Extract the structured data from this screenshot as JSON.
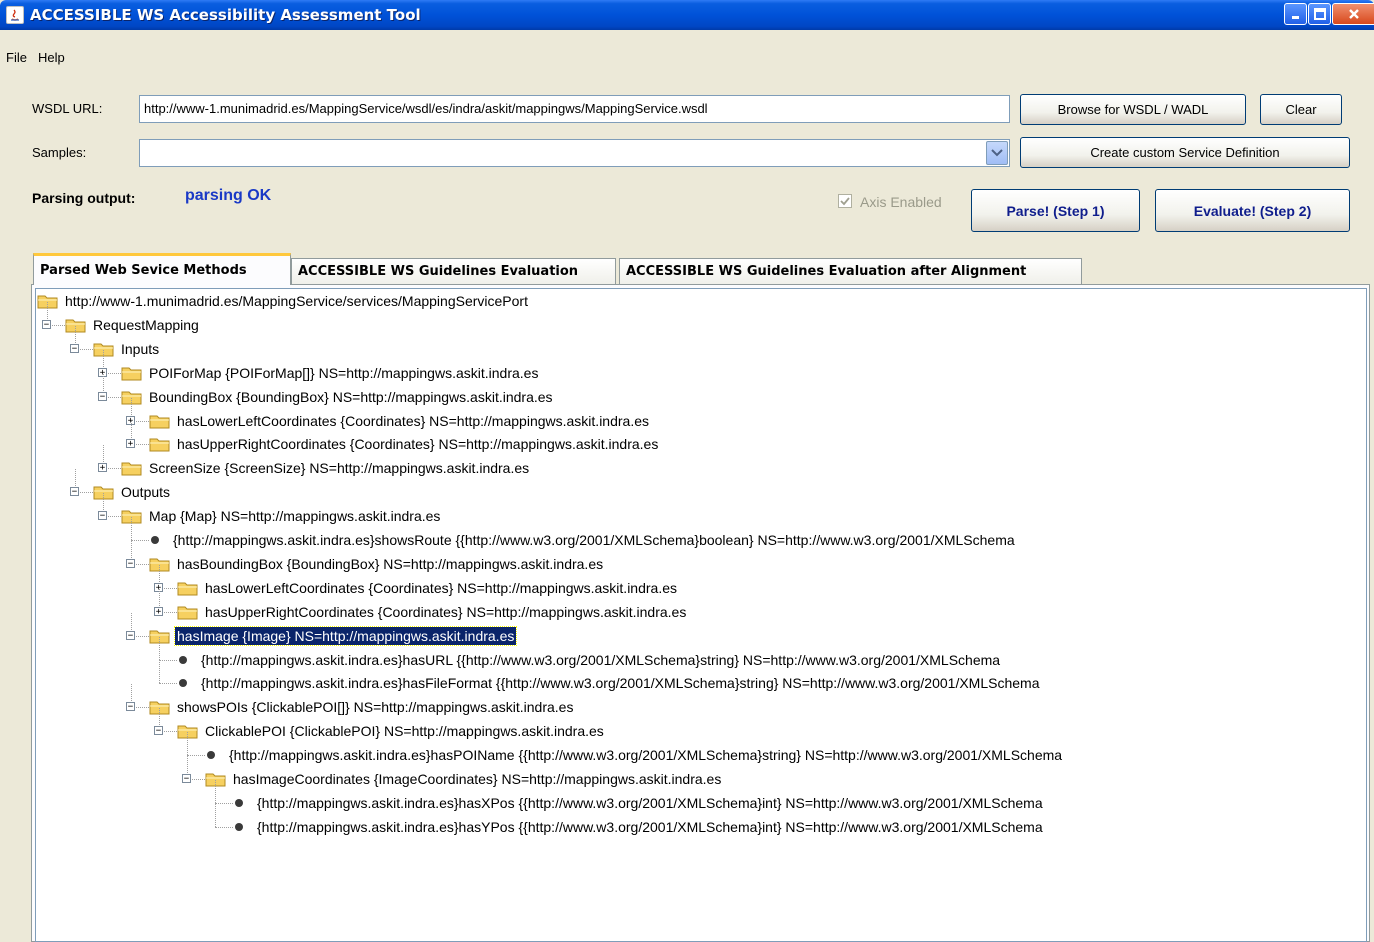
{
  "window": {
    "title": "ACCESSIBLE WS Accessibility Assessment Tool"
  },
  "menu": {
    "file": "File",
    "help": "Help"
  },
  "form": {
    "wsdl_label": "WSDL URL:",
    "wsdl_value": "http://www-1.munimadrid.es/MappingService/wsdl/es/indra/askit/mappingws/MappingService.wsdl",
    "browse_button": "Browse for WSDL / WADL",
    "clear_button": "Clear",
    "samples_label": "Samples:",
    "samples_value": "",
    "custom_button": "Create custom Service Definition",
    "parsing_label": "Parsing output:",
    "parsing_value": "parsing OK",
    "axis_label": "Axis Enabled",
    "axis_checked": true,
    "parse_button": "Parse! (Step 1)",
    "evaluate_button": "Evaluate! (Step 2)"
  },
  "tabs": [
    {
      "label": "Parsed Web Sevice Methods",
      "active": true
    },
    {
      "label": "ACCESSIBLE WS Guidelines Evaluation",
      "active": false
    },
    {
      "label": "ACCESSIBLE WS Guidelines Evaluation after Alignment",
      "active": false
    }
  ],
  "tree": [
    {
      "text": "http://www-1.munimadrid.es/MappingService/services/MappingServicePort",
      "type": "folder",
      "toggle": "none"
    },
    {
      "text": "RequestMapping",
      "type": "folder",
      "toggle": "minus"
    },
    {
      "text": "Inputs",
      "type": "folder",
      "toggle": "minus"
    },
    {
      "text": "POIForMap  {POIForMap[]}    NS=http://mappingws.askit.indra.es",
      "type": "folder",
      "toggle": "plus"
    },
    {
      "text": "BoundingBox  {BoundingBox}    NS=http://mappingws.askit.indra.es",
      "type": "folder",
      "toggle": "minus"
    },
    {
      "text": "hasLowerLeftCoordinates  {Coordinates}    NS=http://mappingws.askit.indra.es",
      "type": "folder",
      "toggle": "plus"
    },
    {
      "text": "hasUpperRightCoordinates  {Coordinates}    NS=http://mappingws.askit.indra.es",
      "type": "folder",
      "toggle": "plus"
    },
    {
      "text": "ScreenSize  {ScreenSize}    NS=http://mappingws.askit.indra.es",
      "type": "folder",
      "toggle": "plus"
    },
    {
      "text": "Outputs",
      "type": "folder",
      "toggle": "minus"
    },
    {
      "text": "Map  {Map}    NS=http://mappingws.askit.indra.es",
      "type": "folder",
      "toggle": "minus"
    },
    {
      "text": "{http://mappingws.askit.indra.es}showsRoute  {{http://www.w3.org/2001/XMLSchema}boolean}    NS=http://www.w3.org/2001/XMLSchema",
      "type": "leaf",
      "toggle": "none"
    },
    {
      "text": "hasBoundingBox  {BoundingBox}    NS=http://mappingws.askit.indra.es",
      "type": "folder",
      "toggle": "minus"
    },
    {
      "text": "hasLowerLeftCoordinates  {Coordinates}    NS=http://mappingws.askit.indra.es",
      "type": "folder",
      "toggle": "plus"
    },
    {
      "text": "hasUpperRightCoordinates  {Coordinates}    NS=http://mappingws.askit.indra.es",
      "type": "folder",
      "toggle": "plus"
    },
    {
      "text": "hasImage  {Image}    NS=http://mappingws.askit.indra.es",
      "type": "folder",
      "toggle": "minus",
      "selected": true
    },
    {
      "text": "{http://mappingws.askit.indra.es}hasURL  {{http://www.w3.org/2001/XMLSchema}string}    NS=http://www.w3.org/2001/XMLSchema",
      "type": "leaf",
      "toggle": "none"
    },
    {
      "text": "{http://mappingws.askit.indra.es}hasFileFormat  {{http://www.w3.org/2001/XMLSchema}string}    NS=http://www.w3.org/2001/XMLSchema",
      "type": "leaf",
      "toggle": "none"
    },
    {
      "text": "showsPOIs  {ClickablePOI[]}    NS=http://mappingws.askit.indra.es",
      "type": "folder",
      "toggle": "minus"
    },
    {
      "text": "ClickablePOI  {ClickablePOI}    NS=http://mappingws.askit.indra.es",
      "type": "folder",
      "toggle": "minus"
    },
    {
      "text": "{http://mappingws.askit.indra.es}hasPOIName  {{http://www.w3.org/2001/XMLSchema}string}    NS=http://www.w3.org/2001/XMLSchema",
      "type": "leaf",
      "toggle": "none"
    },
    {
      "text": "hasImageCoordinates  {ImageCoordinates}    NS=http://mappingws.askit.indra.es",
      "type": "folder",
      "toggle": "minus"
    },
    {
      "text": "{http://mappingws.askit.indra.es}hasXPos  {{http://www.w3.org/2001/XMLSchema}int}    NS=http://www.w3.org/2001/XMLSchema",
      "type": "leaf",
      "toggle": "none"
    },
    {
      "text": "{http://mappingws.askit.indra.es}hasYPos  {{http://www.w3.org/2001/XMLSchema}int}    NS=http://www.w3.org/2001/XMLSchema",
      "type": "leaf",
      "toggle": "none"
    }
  ],
  "colors": {
    "titlebar": "#0052d8",
    "window_bg": "#ece9d8",
    "parsing_ok": "#1a39c6",
    "selection": "#0a246a",
    "folder": "#f6d060"
  }
}
